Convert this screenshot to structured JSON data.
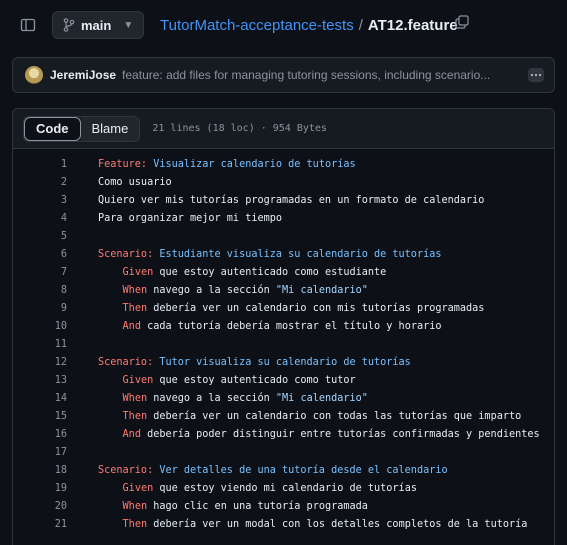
{
  "header": {
    "branch": "main",
    "repo": "TutorMatch-acceptance-tests",
    "separator": "/",
    "file": "AT12.feature"
  },
  "commit": {
    "author": "JeremiJose",
    "message": "feature: add files for managing tutoring sessions, including scenario..."
  },
  "viewer": {
    "tab_code": "Code",
    "tab_blame": "Blame",
    "file_info": "21 lines (18 loc) · 954 Bytes"
  },
  "lines": [
    {
      "n": "1",
      "indent": "",
      "kw": "Feature:",
      "rest": " Visualizar calendario de tutorías",
      "type": "title"
    },
    {
      "n": "2",
      "indent": "",
      "kw": "",
      "rest": "Como usuario",
      "type": "plain"
    },
    {
      "n": "3",
      "indent": "",
      "kw": "",
      "rest": "Quiero ver mis tutorías programadas en un formato de calendario",
      "type": "plain"
    },
    {
      "n": "4",
      "indent": "",
      "kw": "",
      "rest": "Para organizar mejor mi tiempo",
      "type": "plain"
    },
    {
      "n": "5",
      "indent": "",
      "kw": "",
      "rest": "",
      "type": "plain"
    },
    {
      "n": "6",
      "indent": "",
      "kw": "Scenario:",
      "rest": " Estudiante visualiza su calendario de tutorías",
      "type": "title"
    },
    {
      "n": "7",
      "indent": "    ",
      "kw": "Given",
      "rest": " que estoy autenticado como estudiante",
      "type": "step"
    },
    {
      "n": "8",
      "indent": "    ",
      "kw": "When",
      "rest": " navego a la sección ",
      "str": "\"Mi calendario\"",
      "type": "step"
    },
    {
      "n": "9",
      "indent": "    ",
      "kw": "Then",
      "rest": " debería ver un calendario con mis tutorías programadas",
      "type": "step"
    },
    {
      "n": "10",
      "indent": "    ",
      "kw": "And",
      "rest": " cada tutoría debería mostrar el título y horario",
      "type": "step"
    },
    {
      "n": "11",
      "indent": "",
      "kw": "",
      "rest": "",
      "type": "plain"
    },
    {
      "n": "12",
      "indent": "",
      "kw": "Scenario:",
      "rest": " Tutor visualiza su calendario de tutorías",
      "type": "title"
    },
    {
      "n": "13",
      "indent": "    ",
      "kw": "Given",
      "rest": " que estoy autenticado como tutor",
      "type": "step"
    },
    {
      "n": "14",
      "indent": "    ",
      "kw": "When",
      "rest": " navego a la sección ",
      "str": "\"Mi calendario\"",
      "type": "step"
    },
    {
      "n": "15",
      "indent": "    ",
      "kw": "Then",
      "rest": " debería ver un calendario con todas las tutorías que imparto",
      "type": "step"
    },
    {
      "n": "16",
      "indent": "    ",
      "kw": "And",
      "rest": " debería poder distinguir entre tutorías confirmadas y pendientes",
      "type": "step"
    },
    {
      "n": "17",
      "indent": "",
      "kw": "",
      "rest": "",
      "type": "plain"
    },
    {
      "n": "18",
      "indent": "",
      "kw": "Scenario:",
      "rest": " Ver detalles de una tutoría desde el calendario",
      "type": "title"
    },
    {
      "n": "19",
      "indent": "    ",
      "kw": "Given",
      "rest": " que estoy viendo mi calendario de tutorías",
      "type": "step"
    },
    {
      "n": "20",
      "indent": "    ",
      "kw": "When",
      "rest": " hago clic en una tutoría programada",
      "type": "step"
    },
    {
      "n": "21",
      "indent": "    ",
      "kw": "Then",
      "rest": " debería ver un modal con los detalles completos de la tutoría",
      "type": "step"
    }
  ]
}
